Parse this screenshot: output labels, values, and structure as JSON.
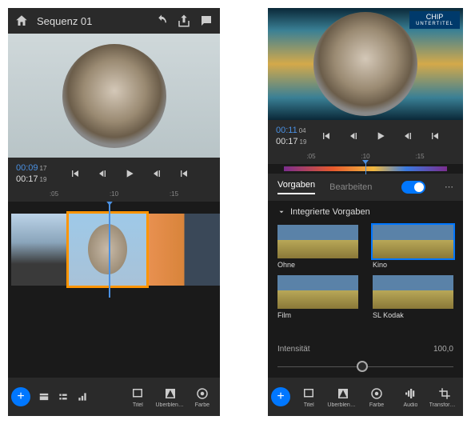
{
  "left": {
    "title": "Sequenz 01",
    "timecode_current": "00:09",
    "timecode_total": "00:17",
    "count_top": "17",
    "count_bottom": "19",
    "ruler": [
      ":05",
      ":10",
      ":15"
    ],
    "bottom": [
      "Titel",
      "Überblendungen",
      "Farbe"
    ]
  },
  "right": {
    "chip_title": "CHIP",
    "chip_sub": "UNTERTITEL",
    "timecode_current": "00:11",
    "timecode_total": "00:17",
    "count_top": "04",
    "count_bottom": "19",
    "ruler": [
      ":05",
      ":10",
      ":15"
    ],
    "tab_active": "Vorgaben",
    "tab_inactive": "Bearbeiten",
    "section": "Integrierte Vorgaben",
    "presets": [
      "Ohne",
      "Kino",
      "Film",
      "SL Kodak"
    ],
    "intensity_label": "Intensität",
    "intensity_value": "100,0",
    "bottom": [
      "Titel",
      "Überblendungen",
      "Farbe",
      "Audio",
      "Transformieren"
    ]
  }
}
